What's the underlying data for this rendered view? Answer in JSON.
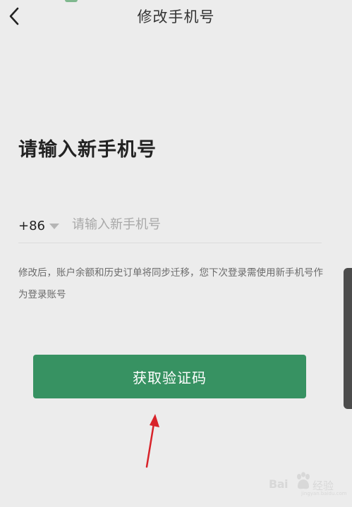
{
  "nav": {
    "title": "修改手机号"
  },
  "form": {
    "heading": "请输入新手机号",
    "country_code": "+86",
    "phone_value": "",
    "phone_placeholder": "请输入新手机号",
    "notice": "修改后，账户余额和历史订单将同步迁移，您下次登录需使用新手机号作为登录账号",
    "submit_label": "获取验证码"
  },
  "watermark": {
    "brand": "Bai",
    "brand_suffix": "经验",
    "url": "jingyan.baidu.com"
  },
  "colors": {
    "background": "#ececec",
    "primary": "#379262",
    "annotation": "#d8232a"
  },
  "icons": {
    "back": "chevron-left-icon",
    "dropdown": "caret-down-icon",
    "annotation": "red-arrow-up-icon",
    "watermark": "baidu-paw-icon"
  }
}
